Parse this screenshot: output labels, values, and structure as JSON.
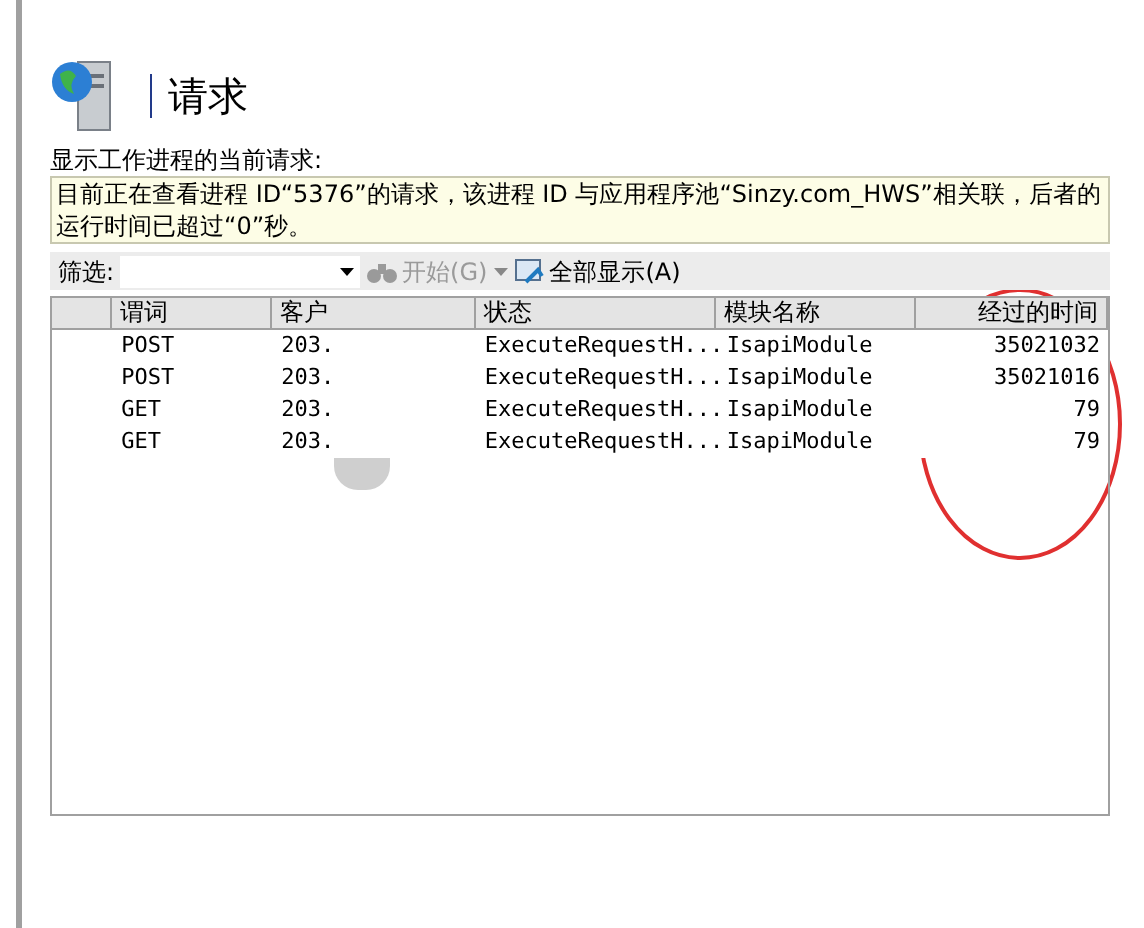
{
  "header": {
    "title": "请求"
  },
  "description": "显示工作进程的当前请求:",
  "info": "目前正在查看进程 ID“5376”的请求，该进程 ID 与应用程序池“Sinzy.com_HWS”相关联，后者的运行时间已超过“0”秒。",
  "toolbar": {
    "filter_label": "筛选:",
    "go": {
      "label": "开始(G)",
      "disabled": true
    },
    "show_all": {
      "label": "全部显示(A)",
      "disabled": false
    }
  },
  "table": {
    "columns": [
      "谓词",
      "客户",
      "状态",
      "模块名称",
      "经过的时间"
    ],
    "rows": [
      {
        "cells": [
          "POST",
          "203.",
          "ExecuteRequestH...",
          "IsapiModule",
          "35021032"
        ]
      },
      {
        "cells": [
          "POST",
          "203.",
          "ExecuteRequestH...",
          "IsapiModule",
          "35021016"
        ]
      },
      {
        "cells": [
          "GET",
          "203.",
          "ExecuteRequestH...",
          "IsapiModule",
          "79"
        ]
      },
      {
        "cells": [
          "GET",
          "203.",
          "ExecuteRequestH...",
          "IsapiModule",
          "79"
        ]
      }
    ]
  }
}
